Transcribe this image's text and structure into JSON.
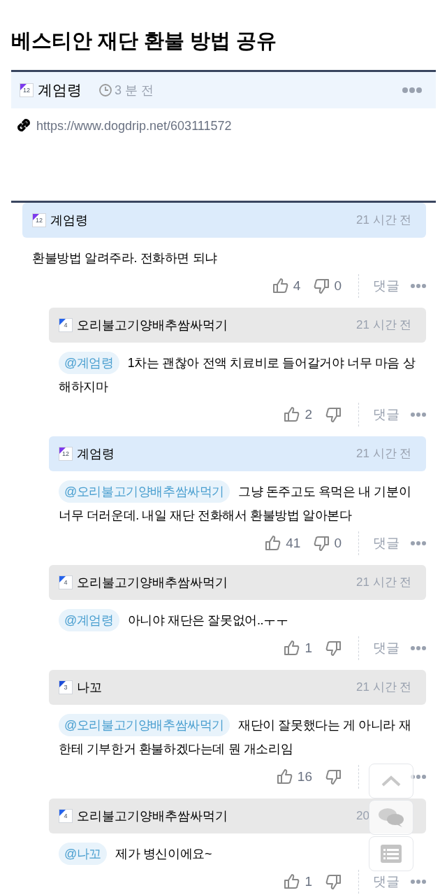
{
  "post": {
    "title": "베스티안 재단 환불 방법 공유",
    "author": {
      "name": "계엄령",
      "level_badge": "12",
      "color": "#7c3aed"
    },
    "time": "3 분 전",
    "link": "https://www.dogdrip.net/603111572"
  },
  "comments": [
    {
      "author": {
        "name": "계엄령",
        "level_badge": "12",
        "color": "#7c3aed"
      },
      "is_post_author": true,
      "time": "21 시간 전",
      "body": "환불방법 알려주라. 전화하면 되냐",
      "likes": "4",
      "dislikes": "0",
      "reply_label": "댓글",
      "children": [
        {
          "author": {
            "name": "오리불고기양배추쌈싸먹기",
            "level_badge": "4",
            "color": "#2563eb"
          },
          "is_post_author": false,
          "time": "21 시간 전",
          "mention": "@계엄령",
          "body": "1차는 괜찮아 전액 치료비로 들어갈거야 너무 마음 상해하지마",
          "likes": "2",
          "reply_label": "댓글"
        },
        {
          "author": {
            "name": "계엄령",
            "level_badge": "12",
            "color": "#7c3aed"
          },
          "is_post_author": true,
          "time": "21 시간 전",
          "mention": "@오리불고기양배추쌈싸먹기",
          "body": "그냥 돈주고도 욕먹은 내 기분이 너무 더러운데. 내일 재단 전화해서 환불방법 알아본다",
          "likes": "41",
          "dislikes": "0",
          "reply_label": "댓글"
        },
        {
          "author": {
            "name": "오리불고기양배추쌈싸먹기",
            "level_badge": "4",
            "color": "#2563eb"
          },
          "is_post_author": false,
          "time": "21 시간 전",
          "mention": "@계엄령",
          "body": "아니야 재단은 잘못없어..ㅜㅜ",
          "likes": "1",
          "reply_label": "댓글"
        },
        {
          "author": {
            "name": "나꼬",
            "level_badge": "3",
            "color": "#1d4ed8"
          },
          "is_post_author": false,
          "time": "21 시간 전",
          "mention": "@오리불고기양배추쌈싸먹기",
          "body": "재단이 잘못했다는 게 아니라 재한테 기부한거 환불하겠다는데 뭔 개소리임",
          "likes": "16"
        },
        {
          "author": {
            "name": "오리불고기양배추쌈싸먹기",
            "level_badge": "4",
            "color": "#2563eb"
          },
          "is_post_author": false,
          "time": "20",
          "mention": "@나꼬",
          "body": "제가 병신이에요~",
          "likes": "1",
          "reply_label": "댓글"
        }
      ]
    }
  ]
}
